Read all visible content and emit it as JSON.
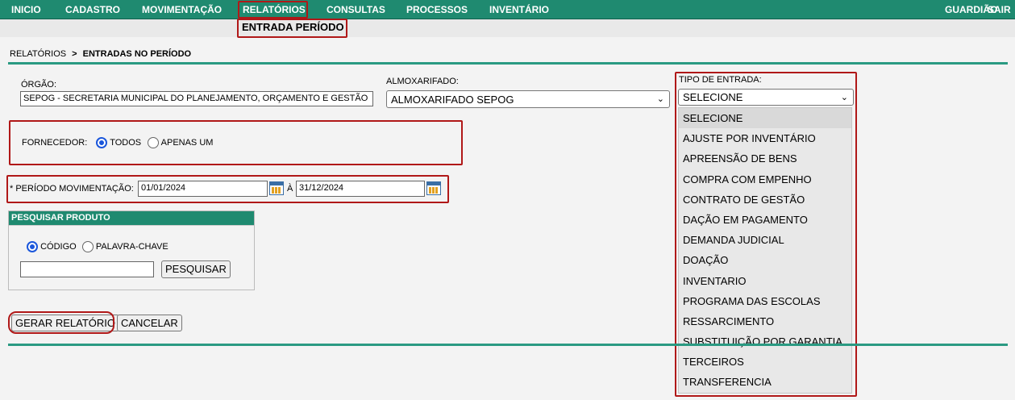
{
  "nav": {
    "items": [
      "INICIO",
      "CADASTRO",
      "MOVIMENTAÇÃO",
      "RELATÓRIOS",
      "CONSULTAS",
      "PROCESSOS",
      "INVENTÁRIO"
    ],
    "right": [
      "GUARDIÃO",
      "SAIR"
    ],
    "submenu": "ENTRADA PERÍODO"
  },
  "breadcrumb": {
    "parent": "RELATÓRIOS",
    "separator": ">",
    "current": "ENTRADAS NO PERÍODO"
  },
  "orgao": {
    "label": "ÓRGÃO:",
    "value": "SEPOG - SECRETARIA MUNICIPAL DO PLANEJAMENTO, ORÇAMENTO E GESTÃO"
  },
  "almoxarifado": {
    "label": "ALMOXARIFADO:",
    "value": "ALMOXARIFADO SEPOG"
  },
  "tipo_entrada": {
    "label": "TIPO DE ENTRADA:",
    "value": "SELECIONE",
    "options": [
      "SELECIONE",
      "AJUSTE POR INVENTÁRIO",
      "APREENSÃO DE BENS",
      "COMPRA COM EMPENHO",
      "CONTRATO DE GESTÃO",
      "DAÇÃO EM PAGAMENTO",
      "DEMANDA JUDICIAL",
      "DOAÇÃO",
      "INVENTARIO",
      "PROGRAMA DAS ESCOLAS",
      "RESSARCIMENTO",
      "SUBSTITUIÇÃO POR GARANTIA",
      "TERCEIROS",
      "TRANSFERENCIA"
    ]
  },
  "fornecedor": {
    "label": "FORNECEDOR:",
    "option_all": "TODOS",
    "option_one": "APENAS UM"
  },
  "periodo": {
    "label": "* PERÍODO MOVIMENTAÇÃO:",
    "start": "01/01/2024",
    "separator": "À",
    "end": "31/12/2024"
  },
  "pesquisar": {
    "title": "PESQUISAR PRODUTO",
    "option_code": "CÓDIGO",
    "option_keyword": "PALAVRA-CHAVE",
    "search_value": "",
    "button": "PESQUISAR"
  },
  "actions": {
    "generate": "GERAR RELATÓRIO",
    "cancel": "CANCELAR"
  },
  "colors": {
    "header": "#1f8a70",
    "highlight": "#b01818",
    "radio": "#1a56db"
  },
  "icons": [
    "calendar-icon",
    "chevron-down-icon"
  ]
}
